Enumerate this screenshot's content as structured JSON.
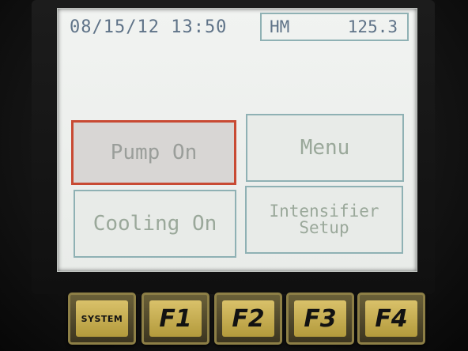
{
  "status": {
    "datetime": "08/15/12 13:50",
    "mode": "HM",
    "value": "125.3"
  },
  "buttons": {
    "pump": "Pump On",
    "menu": "Menu",
    "cooling": "Cooling On",
    "intensifier": "Intensifier\nSetup"
  },
  "keys": {
    "system": "SYSTEM",
    "f1": "F1",
    "f2": "F2",
    "f3": "F3",
    "f4": "F4"
  },
  "colors": {
    "text": "#5f7388",
    "button_border": "#8fb1b4",
    "pressed_border": "#c84a33",
    "key_face": "#d9c16a"
  }
}
